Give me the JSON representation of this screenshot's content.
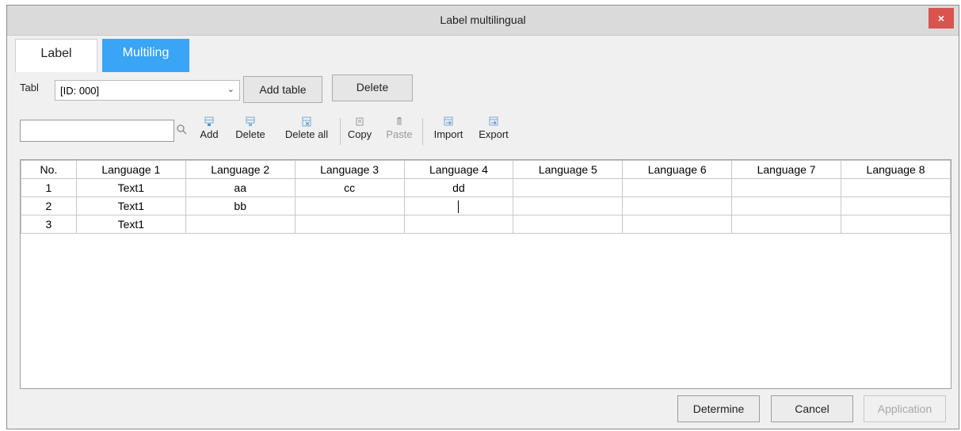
{
  "window": {
    "title": "Label multilingual",
    "close_label": "×"
  },
  "tabs": [
    {
      "label": "Label"
    },
    {
      "label": "Multiling"
    }
  ],
  "table_select": {
    "label": "Tabl",
    "value": "[ID: 000]"
  },
  "buttons": {
    "add_table": "Add table",
    "delete": "Delete"
  },
  "toolbar": {
    "search_value": "",
    "items": [
      {
        "label": "Add",
        "enabled": true
      },
      {
        "label": "Delete",
        "enabled": true
      },
      {
        "label": "Delete all",
        "enabled": true
      },
      {
        "label": "Copy",
        "enabled": true
      },
      {
        "label": "Paste",
        "enabled": false
      },
      {
        "label": "Import",
        "enabled": true
      },
      {
        "label": "Export",
        "enabled": true
      }
    ]
  },
  "grid": {
    "columns": [
      "No.",
      "Language 1",
      "Language 2",
      "Language 3",
      "Language 4",
      "Language 5",
      "Language 6",
      "Language 7",
      "Language 8"
    ],
    "rows": [
      [
        "1",
        "Text1",
        "aa",
        "cc",
        "dd",
        "",
        "",
        "",
        ""
      ],
      [
        "2",
        "Text1",
        "bb",
        "",
        "",
        "",
        "",
        "",
        ""
      ],
      [
        "3",
        "Text1",
        "",
        "",
        "",
        "",
        "",
        "",
        ""
      ]
    ]
  },
  "footer": {
    "determine": "Determine",
    "cancel": "Cancel",
    "application": "Application"
  },
  "colors": {
    "tab_active": "#3aa4f5",
    "close": "#d9534f"
  }
}
